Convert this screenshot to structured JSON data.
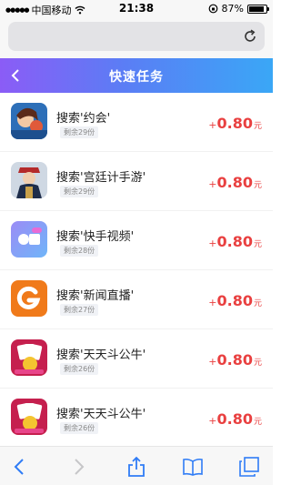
{
  "status_bar": {
    "carrier": "中国移动",
    "time": "21:38",
    "battery": "87%",
    "battery_level": 0.87
  },
  "header": {
    "title": "快速任务"
  },
  "tasks": [
    {
      "title": "搜索'约会'",
      "remaining": "剩余29份",
      "plus": "+",
      "amount": "0.80",
      "unit": "元",
      "icon": "dating-game-icon"
    },
    {
      "title": "搜索'宫廷计手游'",
      "remaining": "剩余29份",
      "plus": "+",
      "amount": "0.80",
      "unit": "元",
      "icon": "palace-game-icon"
    },
    {
      "title": "搜索'快手视频'",
      "remaining": "剩余28份",
      "plus": "+",
      "amount": "0.80",
      "unit": "元",
      "icon": "kuaishou-video-icon"
    },
    {
      "title": "搜索'新闻直播'",
      "remaining": "剩余27份",
      "plus": "+",
      "amount": "0.80",
      "unit": "元",
      "icon": "news-live-icon"
    },
    {
      "title": "搜索'天天斗公牛'",
      "remaining": "剩余26份",
      "plus": "+",
      "amount": "0.80",
      "unit": "元",
      "icon": "poker-game-icon"
    },
    {
      "title": "搜索'天天斗公牛'",
      "remaining": "剩余26份",
      "plus": "+",
      "amount": "0.80",
      "unit": "元",
      "icon": "poker-game-icon"
    }
  ],
  "colors": {
    "accent": "#e94040",
    "header_start": "#8b5cf6",
    "header_end": "#3aa7f6",
    "toolbar_icon": "#2f7cf6"
  }
}
